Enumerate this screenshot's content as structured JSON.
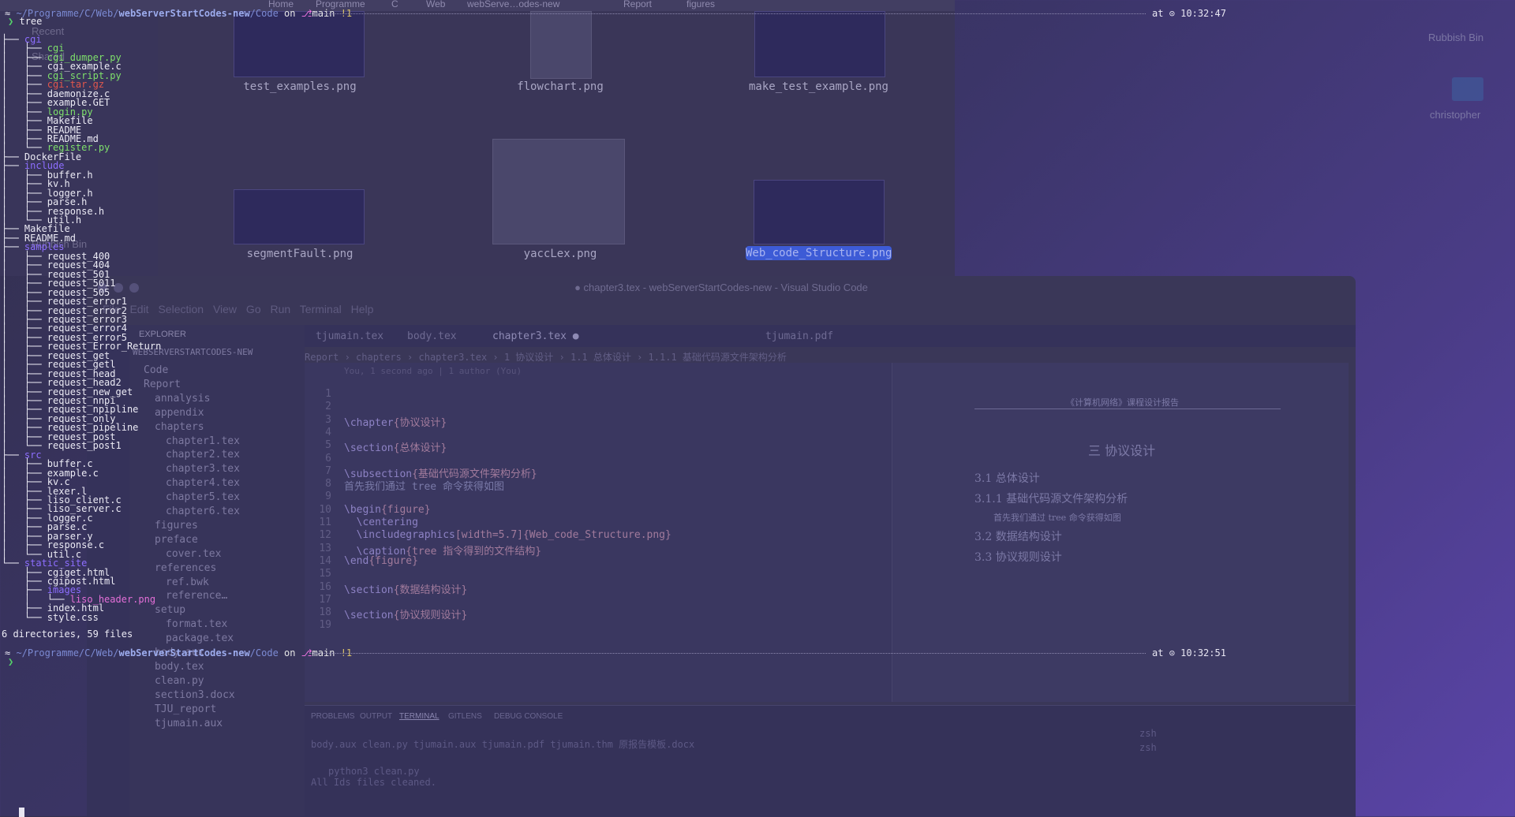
{
  "finder": {
    "crumbs": [
      "Home",
      "Programme",
      "C",
      "Web",
      "webServe…odes-new",
      "Report",
      "figures"
    ],
    "sidebar": [
      "Recent",
      "Shared",
      "Rubbish Bin"
    ],
    "thumbs": [
      {
        "label": "test_examples.png"
      },
      {
        "label": "flowchart.png"
      },
      {
        "label": "make_test_example.png"
      },
      {
        "label": "segmentFault.png"
      },
      {
        "label": "yaccLex.png"
      },
      {
        "label": "Web_code_Structure.png"
      }
    ]
  },
  "desktop": {
    "user_label": "Rubbish Bin",
    "folder_label": "christopher"
  },
  "vscode": {
    "title": "● chapter3.tex - webServerStartCodes-new - Visual Studio Code",
    "menu": "File Edit Selection View Go Run Terminal Help",
    "explorer_header": "EXPLORER",
    "project": "WEBSERVERSTARTCODES-NEW",
    "explorer_items": [
      {
        "label": "Code",
        "indent": 1
      },
      {
        "label": "Report",
        "indent": 1
      },
      {
        "label": "annalysis",
        "indent": 2
      },
      {
        "label": "appendix",
        "indent": 2
      },
      {
        "label": "chapters",
        "indent": 2
      },
      {
        "label": "chapter1.tex",
        "indent": 3
      },
      {
        "label": "chapter2.tex",
        "indent": 3
      },
      {
        "label": "chapter3.tex",
        "indent": 3
      },
      {
        "label": "chapter4.tex",
        "indent": 3
      },
      {
        "label": "chapter5.tex",
        "indent": 3
      },
      {
        "label": "chapter6.tex",
        "indent": 3
      },
      {
        "label": "figures",
        "indent": 2
      },
      {
        "label": "preface",
        "indent": 2
      },
      {
        "label": "cover.tex",
        "indent": 3
      },
      {
        "label": "references",
        "indent": 2
      },
      {
        "label": "ref.bwk",
        "indent": 3
      },
      {
        "label": "reference…",
        "indent": 3
      },
      {
        "label": "setup",
        "indent": 2
      },
      {
        "label": "format.tex",
        "indent": 3
      },
      {
        "label": "package.tex",
        "indent": 3
      },
      {
        "label": "body.aux",
        "indent": 2
      },
      {
        "label": "body.tex",
        "indent": 2
      },
      {
        "label": "clean.py",
        "indent": 2
      },
      {
        "label": "section3.docx",
        "indent": 2
      },
      {
        "label": "TJU_report",
        "indent": 2
      },
      {
        "label": "tjumain.aux",
        "indent": 2
      }
    ],
    "tabs": [
      "tjumain.tex",
      "body.tex",
      "chapter3.tex ●",
      "tjumain.pdf"
    ],
    "breadcrumb": "Report › chapters › chapter3.tex › 1 协议设计 › 1.1 总体设计 › 1.1.1 基础代码源文件架构分析",
    "blame": "You, 1 second ago | 1 author (You)",
    "code_lines": [
      {
        "n": "1",
        "t": ""
      },
      {
        "n": "2",
        "t": ""
      },
      {
        "n": "3",
        "k": "\\chapter",
        "a": "{协议设计}"
      },
      {
        "n": "4",
        "t": ""
      },
      {
        "n": "5",
        "k": "\\section",
        "a": "{总体设计}"
      },
      {
        "n": "6",
        "t": ""
      },
      {
        "n": "7",
        "k": "\\subsection",
        "a": "{基础代码源文件架构分析}"
      },
      {
        "n": "8",
        "t": "首先我们通过 tree 命令获得如图"
      },
      {
        "n": "9",
        "t": ""
      },
      {
        "n": "10",
        "k": "\\begin",
        "a": "{figure}"
      },
      {
        "n": "11",
        "k": "  \\centering",
        "a": ""
      },
      {
        "n": "12",
        "k": "  \\includegraphics",
        "a": "[width=5.7]{Web_code_Structure.png}"
      },
      {
        "n": "13",
        "k": "  \\caption",
        "a": "{tree 指令得到的文件结构}"
      },
      {
        "n": "14",
        "k": "\\end",
        "a": "{figure}"
      },
      {
        "n": "15",
        "t": ""
      },
      {
        "n": "16",
        "k": "\\section",
        "a": "{数据结构设计}"
      },
      {
        "n": "17",
        "t": ""
      },
      {
        "n": "18",
        "k": "\\section",
        "a": "{协议规则设计}"
      },
      {
        "n": "19",
        "t": ""
      }
    ],
    "pdf": {
      "header": "《计算机网络》课程设计报告",
      "chapter": "三    协议设计",
      "s1": "3.1   总体设计",
      "s11": "3.1.1   基础代码源文件架构分析",
      "p1": "首先我们通过 tree 命令获得如图",
      "s2": "3.2   数据结构设计",
      "s3": "3.3   协议规则设计"
    },
    "panel_tabs": [
      "PROBLEMS",
      "OUTPUT",
      "TERMINAL",
      "GITLENS",
      "DEBUG CONSOLE"
    ],
    "panel_files": "body.aux    clean.py              tjumain.aux     tjumain.pdf   tjumain.thm       原报告模板.docx",
    "panel_cmd": "python3 clean.py",
    "panel_out": "All Ids files cleaned.",
    "shells": [
      "zsh",
      "zsh"
    ]
  },
  "terminal": {
    "path_prefix": "~/Programme/C/Web/",
    "path_bold": "webServerStartCodes-new",
    "path_suffix": "/Code",
    "on": "on",
    "branch": "main",
    "dirty": "!1",
    "at": "at",
    "time_top": "10:32:47",
    "time_bottom": "10:32:51",
    "cmd": "tree",
    "summary": "6 directories, 59 files",
    "tree": [
      {
        "p": "├── ",
        "n": "cgi",
        "c": "dir"
      },
      {
        "p": "│   ├── ",
        "n": "cgi",
        "c": "exe"
      },
      {
        "p": "│   ├── ",
        "n": "cgi_dumper.py",
        "c": "exe"
      },
      {
        "p": "│   ├── ",
        "n": "cgi_example.c",
        "c": ""
      },
      {
        "p": "│   ├── ",
        "n": "cgi_script.py",
        "c": "exe"
      },
      {
        "p": "│   ├── ",
        "n": "cgi.tar.gz",
        "c": "arc"
      },
      {
        "p": "│   ├── ",
        "n": "daemonize.c",
        "c": ""
      },
      {
        "p": "│   ├── ",
        "n": "example.GET",
        "c": ""
      },
      {
        "p": "│   ├── ",
        "n": "login.py",
        "c": "exe"
      },
      {
        "p": "│   ├── ",
        "n": "Makefile",
        "c": ""
      },
      {
        "p": "│   ├── ",
        "n": "README",
        "c": ""
      },
      {
        "p": "│   ├── ",
        "n": "README.md",
        "c": ""
      },
      {
        "p": "│   └── ",
        "n": "register.py",
        "c": "exe"
      },
      {
        "p": "├── ",
        "n": "DockerFile",
        "c": ""
      },
      {
        "p": "├── ",
        "n": "include",
        "c": "dir"
      },
      {
        "p": "│   ├── ",
        "n": "buffer.h",
        "c": ""
      },
      {
        "p": "│   ├── ",
        "n": "kv.h",
        "c": ""
      },
      {
        "p": "│   ├── ",
        "n": "logger.h",
        "c": ""
      },
      {
        "p": "│   ├── ",
        "n": "parse.h",
        "c": ""
      },
      {
        "p": "│   ├── ",
        "n": "response.h",
        "c": ""
      },
      {
        "p": "│   └── ",
        "n": "util.h",
        "c": ""
      },
      {
        "p": "├── ",
        "n": "Makefile",
        "c": ""
      },
      {
        "p": "├── ",
        "n": "README.md",
        "c": ""
      },
      {
        "p": "├── ",
        "n": "samples",
        "c": "dir"
      },
      {
        "p": "│   ├── ",
        "n": "request_400",
        "c": ""
      },
      {
        "p": "│   ├── ",
        "n": "request_404",
        "c": ""
      },
      {
        "p": "│   ├── ",
        "n": "request_501",
        "c": ""
      },
      {
        "p": "│   ├── ",
        "n": "request_5011",
        "c": ""
      },
      {
        "p": "│   ├── ",
        "n": "request_505",
        "c": ""
      },
      {
        "p": "│   ├── ",
        "n": "request_error1",
        "c": ""
      },
      {
        "p": "│   ├── ",
        "n": "request_error2",
        "c": ""
      },
      {
        "p": "│   ├── ",
        "n": "request_error3",
        "c": ""
      },
      {
        "p": "│   ├── ",
        "n": "request_error4",
        "c": ""
      },
      {
        "p": "│   ├── ",
        "n": "request_error5",
        "c": ""
      },
      {
        "p": "│   ├── ",
        "n": "request_Error_Return",
        "c": ""
      },
      {
        "p": "│   ├── ",
        "n": "request_get",
        "c": ""
      },
      {
        "p": "│   ├── ",
        "n": "request_getl",
        "c": ""
      },
      {
        "p": "│   ├── ",
        "n": "request_head",
        "c": ""
      },
      {
        "p": "│   ├── ",
        "n": "request_head2",
        "c": ""
      },
      {
        "p": "│   ├── ",
        "n": "request_new_get",
        "c": ""
      },
      {
        "p": "│   ├── ",
        "n": "request_nnpi",
        "c": ""
      },
      {
        "p": "│   ├── ",
        "n": "request_npipline",
        "c": ""
      },
      {
        "p": "│   ├── ",
        "n": "request_only",
        "c": ""
      },
      {
        "p": "│   ├── ",
        "n": "request_pipeline",
        "c": ""
      },
      {
        "p": "│   ├── ",
        "n": "request_post",
        "c": ""
      },
      {
        "p": "│   └── ",
        "n": "request_post1",
        "c": ""
      },
      {
        "p": "├── ",
        "n": "src",
        "c": "dir"
      },
      {
        "p": "│   ├── ",
        "n": "buffer.c",
        "c": ""
      },
      {
        "p": "│   ├── ",
        "n": "example.c",
        "c": ""
      },
      {
        "p": "│   ├── ",
        "n": "kv.c",
        "c": ""
      },
      {
        "p": "│   ├── ",
        "n": "lexer.l",
        "c": ""
      },
      {
        "p": "│   ├── ",
        "n": "liso_client.c",
        "c": ""
      },
      {
        "p": "│   ├── ",
        "n": "liso_server.c",
        "c": ""
      },
      {
        "p": "│   ├── ",
        "n": "logger.c",
        "c": ""
      },
      {
        "p": "│   ├── ",
        "n": "parse.c",
        "c": ""
      },
      {
        "p": "│   ├── ",
        "n": "parser.y",
        "c": ""
      },
      {
        "p": "│   ├── ",
        "n": "response.c",
        "c": ""
      },
      {
        "p": "│   └── ",
        "n": "util.c",
        "c": ""
      },
      {
        "p": "└── ",
        "n": "static_site",
        "c": "dir"
      },
      {
        "p": "    ├── ",
        "n": "cgiget.html",
        "c": ""
      },
      {
        "p": "    ├── ",
        "n": "cgipost.html",
        "c": ""
      },
      {
        "p": "    ├── ",
        "n": "images",
        "c": "dir"
      },
      {
        "p": "    │   └── ",
        "n": "liso_header.png",
        "c": "img"
      },
      {
        "p": "    ├── ",
        "n": "index.html",
        "c": ""
      },
      {
        "p": "    └── ",
        "n": "style.css",
        "c": ""
      }
    ]
  }
}
